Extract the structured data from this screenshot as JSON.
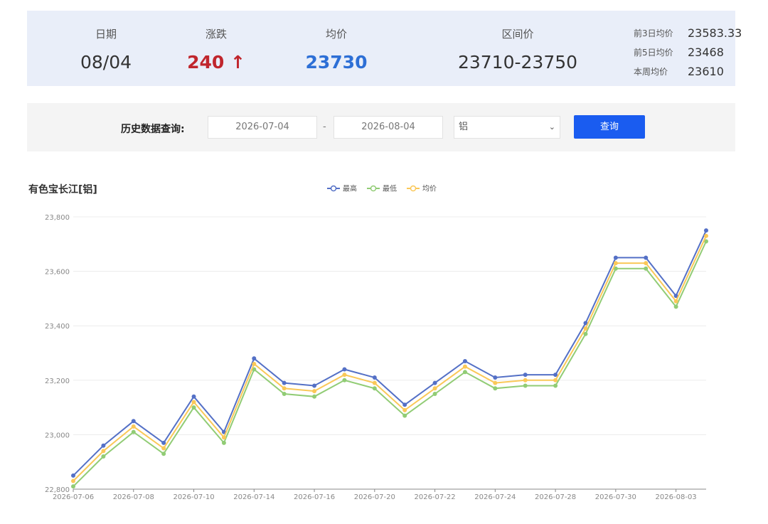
{
  "summary": {
    "date_label": "日期",
    "date_value": "08/04",
    "change_label": "涨跌",
    "change_value": "240 ↑",
    "avg_label": "均价",
    "avg_value": "23730",
    "range_label": "区间价",
    "range_value": "23710-23750",
    "side": [
      {
        "label": "前3日均价",
        "value": "23583.33"
      },
      {
        "label": "前5日均价",
        "value": "23468"
      },
      {
        "label": "本周均价",
        "value": "23610"
      }
    ]
  },
  "query": {
    "label": "历史数据查询:",
    "start_date": "2026-07-04",
    "separator": "-",
    "end_date": "2026-08-04",
    "metal": "铝",
    "button": "查询"
  },
  "colors": {
    "high": "#5470c6",
    "low": "#91cc75",
    "avg": "#fac858",
    "up": "#c0262d",
    "avg_value": "#2d6fd6",
    "button": "#1a5cf0",
    "summary_bg": "#e9eef9"
  },
  "chart_data": {
    "type": "line",
    "title": "有色宝长江[铝]",
    "x": [
      "2026-07-06",
      "2026-07-07",
      "2026-07-08",
      "2026-07-09",
      "2026-07-10",
      "2026-07-13",
      "2026-07-14",
      "2026-07-15",
      "2026-07-16",
      "2026-07-17",
      "2026-07-20",
      "2026-07-21",
      "2026-07-22",
      "2026-07-23",
      "2026-07-24",
      "2026-07-27",
      "2026-07-28",
      "2026-07-29",
      "2026-07-30",
      "2026-07-31",
      "2026-08-03",
      "2026-08-04"
    ],
    "x_tick_labels": [
      "2026-07-06",
      "2026-07-08",
      "2026-07-10",
      "2026-07-14",
      "2026-07-16",
      "2026-07-20",
      "2026-07-22",
      "2026-07-24",
      "2026-07-28",
      "2026-07-30",
      "2026-08-03"
    ],
    "series": [
      {
        "name": "最高",
        "values": [
          22850,
          22960,
          23050,
          22970,
          23140,
          23010,
          23280,
          23190,
          23180,
          23240,
          23210,
          23110,
          23190,
          23270,
          23210,
          23220,
          23220,
          23410,
          23650,
          23650,
          23510,
          23750
        ]
      },
      {
        "name": "最低",
        "values": [
          22810,
          22920,
          23010,
          22930,
          23100,
          22970,
          23240,
          23150,
          23140,
          23200,
          23170,
          23070,
          23150,
          23230,
          23170,
          23180,
          23180,
          23370,
          23610,
          23610,
          23470,
          23710
        ]
      },
      {
        "name": "均价",
        "values": [
          22830,
          22940,
          23030,
          22950,
          23120,
          22990,
          23260,
          23170,
          23160,
          23220,
          23190,
          23090,
          23170,
          23250,
          23190,
          23200,
          23200,
          23390,
          23630,
          23630,
          23490,
          23730
        ]
      }
    ],
    "y_ticks": [
      "22,800",
      "23,000",
      "23,200",
      "23,400",
      "23,600",
      "23,800"
    ],
    "ylim": [
      22800,
      23800
    ],
    "grid": "horizontal",
    "legend_position": "top-center"
  }
}
